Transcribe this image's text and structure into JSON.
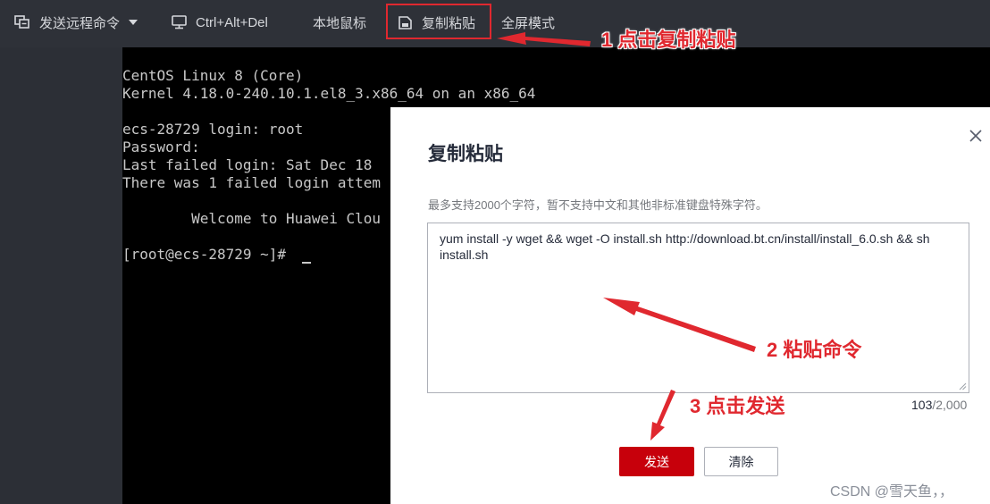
{
  "toolbar": {
    "send_remote_cmd": "发送远程命令",
    "ctrl_alt_del": "Ctrl+Alt+Del",
    "local_mouse": "本地鼠标",
    "copy_paste": "复制粘贴",
    "fullscreen": "全屏模式"
  },
  "terminal": {
    "lines": [
      "CentOS Linux 8 (Core)",
      "Kernel 4.18.0-240.10.1.el8_3.x86_64 on an x86_64",
      "",
      "ecs-28729 login: root",
      "Password:",
      "Last failed login: Sat Dec 18",
      "There was 1 failed login attem",
      "",
      "        Welcome to Huawei Clou",
      "",
      "[root@ecs-28729 ~]# "
    ]
  },
  "dialog": {
    "title": "复制粘贴",
    "hint": "最多支持2000个字符，暂不支持中文和其他非标准键盘特殊字符。",
    "textarea_value": "yum install -y wget && wget -O install.sh http://download.bt.cn/install/install_6.0.sh && sh install.sh",
    "counter_current": "103",
    "counter_max": "/2,000",
    "send_label": "发送",
    "clear_label": "清除"
  },
  "annotations": {
    "step1": "1 点击复制粘贴",
    "step2": "2 粘贴命令",
    "step3": "3 点击发送",
    "color": "#e0282f"
  },
  "watermark": "CSDN @雪天鱼，，",
  "colors": {
    "toolbar_bg": "#2e3138",
    "terminal_bg": "#000000",
    "primary_button": "#c7000b"
  }
}
